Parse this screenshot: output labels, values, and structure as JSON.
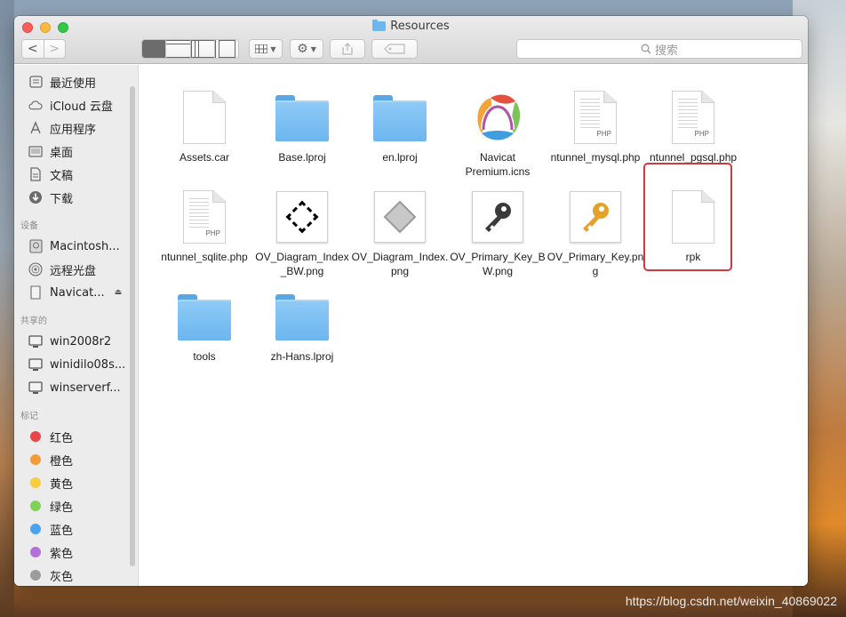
{
  "window": {
    "title": "Resources",
    "search_placeholder": "搜索"
  },
  "toolbar": {
    "back": "<",
    "forward": ">"
  },
  "sidebar": {
    "favorites": [
      {
        "label": "最近使用",
        "icon": "recents-icon"
      },
      {
        "label": "iCloud 云盘",
        "icon": "icloud-icon"
      },
      {
        "label": "应用程序",
        "icon": "applications-icon"
      },
      {
        "label": "桌面",
        "icon": "desktop-icon"
      },
      {
        "label": "文稿",
        "icon": "documents-icon"
      },
      {
        "label": "下载",
        "icon": "downloads-icon"
      }
    ],
    "devices_header": "设备",
    "devices": [
      {
        "label": "Macintosh...",
        "icon": "harddisk-icon"
      },
      {
        "label": "远程光盘",
        "icon": "optical-disc-icon"
      },
      {
        "label": "Navicat...",
        "icon": "volume-icon"
      }
    ],
    "shared_header": "共享的",
    "shared": [
      {
        "label": "win2008r2",
        "icon": "monitor-icon"
      },
      {
        "label": "winidilo08s...",
        "icon": "monitor-icon"
      },
      {
        "label": "winserverf...",
        "icon": "monitor-icon"
      }
    ],
    "tags_header": "标记",
    "tags": [
      {
        "label": "红色",
        "color": "#e8474a"
      },
      {
        "label": "橙色",
        "color": "#f39c3a"
      },
      {
        "label": "黄色",
        "color": "#f7cd3d"
      },
      {
        "label": "绿色",
        "color": "#7fd15a"
      },
      {
        "label": "蓝色",
        "color": "#4aa3ee"
      },
      {
        "label": "紫色",
        "color": "#b56fd6"
      },
      {
        "label": "灰色",
        "color": "#9b9b9b"
      }
    ]
  },
  "files": [
    {
      "name": "Assets.car",
      "kind": "doc"
    },
    {
      "name": "Base.lproj",
      "kind": "folder"
    },
    {
      "name": "en.lproj",
      "kind": "folder"
    },
    {
      "name": "Navicat Premium.icns",
      "kind": "icns"
    },
    {
      "name": "ntunnel_mysql.php",
      "kind": "php",
      "ext": "PHP"
    },
    {
      "name": "ntunnel_pgsql.php",
      "kind": "php",
      "ext": "PHP"
    },
    {
      "name": "ntunnel_sqlite.php",
      "kind": "php",
      "ext": "PHP"
    },
    {
      "name": "OV_Diagram_Index_BW.png",
      "kind": "png"
    },
    {
      "name": "OV_Diagram_Index.png",
      "kind": "png"
    },
    {
      "name": "OV_Primary_Key_BW.png",
      "kind": "png"
    },
    {
      "name": "OV_Primary_Key.png",
      "kind": "png"
    },
    {
      "name": "rpk",
      "kind": "doc"
    },
    {
      "name": "tools",
      "kind": "folder"
    },
    {
      "name": "zh-Hans.lproj",
      "kind": "folder"
    }
  ],
  "watermark": "https://blog.csdn.net/weixin_40869022"
}
